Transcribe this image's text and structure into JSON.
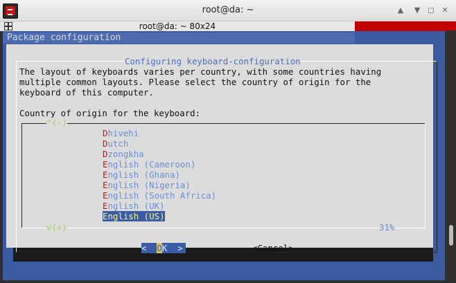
{
  "window": {
    "title": "root@da: ~",
    "buttons": [
      "up-icon",
      "down-icon",
      "maximize-icon",
      "close-icon"
    ]
  },
  "tab": {
    "title": "root@da: ~ 80x24"
  },
  "terminal": {
    "package_config_title": "Package configuration",
    "dialog_title": "Configuring keyboard-configuration",
    "description": [
      "The layout of keyboards varies per country, with some countries having",
      "multiple common layouts. Please select the country of origin for the",
      "keyboard of this computer."
    ],
    "prompt": "Country of origin for the keyboard:",
    "scroll_up": "^(-)",
    "scroll_down": "v(+)",
    "scroll_percent": "31%",
    "items": [
      {
        "hotkey": "D",
        "rest": "hivehi",
        "selected": false
      },
      {
        "hotkey": "D",
        "rest": "utch",
        "selected": false
      },
      {
        "hotkey": "D",
        "rest": "zongkha",
        "selected": false
      },
      {
        "hotkey": "E",
        "rest": "nglish (Cameroon)",
        "selected": false
      },
      {
        "hotkey": "E",
        "rest": "nglish (Ghana)",
        "selected": false
      },
      {
        "hotkey": "E",
        "rest": "nglish (Nigeria)",
        "selected": false
      },
      {
        "hotkey": "E",
        "rest": "nglish (South Africa)",
        "selected": false
      },
      {
        "hotkey": "E",
        "rest": "nglish (UK)",
        "selected": false
      },
      {
        "hotkey": "E",
        "rest": "nglish (US)",
        "selected": true
      }
    ],
    "ok_button": {
      "left": "<",
      "hotkey": "O",
      "rest": "K",
      "right": ">"
    },
    "cancel_button": "<Cancel>"
  },
  "colors": {
    "terminal_blue": "#3a5b9f",
    "dialog_gray": "#dcdcdc",
    "selection": "#3a5ba8",
    "hotkey_red": "#d01010",
    "scroll_green": "#a6d84d"
  }
}
